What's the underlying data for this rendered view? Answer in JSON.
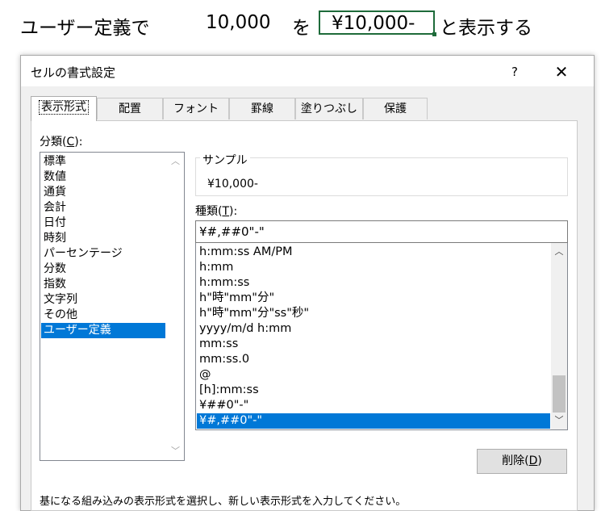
{
  "header": {
    "text_left": "ユーザー定義で",
    "value": "10,000",
    "particle_wo": "を",
    "cell_value": "¥10,000-",
    "text_right": "と表示する"
  },
  "dialog": {
    "title": "セルの書式設定",
    "help": "?",
    "close": "✕"
  },
  "tabs": [
    {
      "label": "表示形式",
      "active": true
    },
    {
      "label": "配置"
    },
    {
      "label": "フォント"
    },
    {
      "label": "罫線"
    },
    {
      "label": "塗りつぶし"
    },
    {
      "label": "保護"
    }
  ],
  "category": {
    "label": "分類(",
    "label_key": "C",
    "label_end": "):",
    "items": [
      "標準",
      "数値",
      "通貨",
      "会計",
      "日付",
      "時刻",
      "パーセンテージ",
      "分数",
      "指数",
      "文字列",
      "その他",
      "ユーザー定義"
    ],
    "selected_index": 11
  },
  "sample": {
    "caption": "サンプル",
    "value": "¥10,000-"
  },
  "type": {
    "label": "種類(",
    "label_key": "T",
    "label_end": "):",
    "input_value": "¥#,##0\"-\"",
    "formats": [
      "h:mm:ss AM/PM",
      "h:mm",
      "h:mm:ss",
      "h\"時\"mm\"分\"",
      "h\"時\"mm\"分\"ss\"秒\"",
      "yyyy/m/d h:mm",
      "mm:ss",
      "mm:ss.0",
      "@",
      "[h]:mm:ss",
      "¥##0\"-\"",
      "¥#,##0\"-\""
    ],
    "selected_index": 11
  },
  "buttons": {
    "delete": "削除(",
    "delete_key": "D",
    "delete_end": ")"
  },
  "hint": "基になる組み込みの表示形式を選択し、新しい表示形式を入力してください。",
  "colors": {
    "selection": "#0078d7",
    "cell_border": "#1e6b3a"
  }
}
